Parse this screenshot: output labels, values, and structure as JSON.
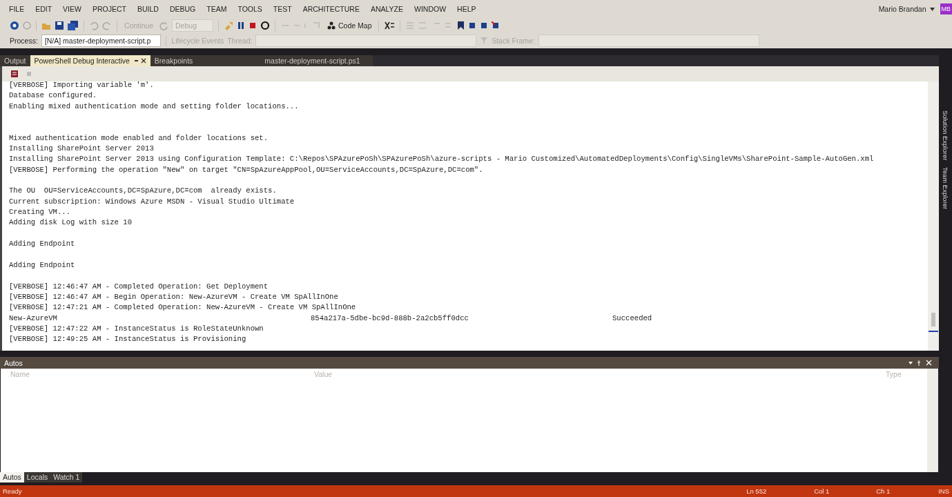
{
  "menu": [
    "FILE",
    "EDIT",
    "VIEW",
    "PROJECT",
    "BUILD",
    "DEBUG",
    "TEAM",
    "TOOLS",
    "TEST",
    "ARCHITECTURE",
    "ANALYZE",
    "WINDOW",
    "HELP"
  ],
  "user": {
    "name": "Mario Brandan",
    "badge": "MB"
  },
  "toolbar": {
    "continue": "Continue",
    "config": "Debug",
    "code_map": "Code Map"
  },
  "debug_location": {
    "process_label": "Process:",
    "process": "[N/A] master-deployment-script.p",
    "lifecycle": "Lifecycle Events",
    "thread_label": "Thread:",
    "stack_frame_label": "Stack Frame:"
  },
  "doc_tabs": [
    {
      "label": "Output",
      "selected": false
    },
    {
      "label": "PowerShell Debug Interactive",
      "selected": true
    },
    {
      "label": "Breakpoints",
      "selected": false
    },
    {
      "label": "master-deployment-script.ps1",
      "selected": false
    }
  ],
  "console": [
    {
      "kind": "text",
      "text": "[VERBOSE] Importing variable 'm'."
    },
    {
      "kind": "text",
      "text": "Database configured."
    },
    {
      "kind": "text",
      "text": "Enabling mixed authentication mode and setting folder locations..."
    },
    {
      "kind": "blank"
    },
    {
      "kind": "blank"
    },
    {
      "kind": "text",
      "text": "Mixed authentication mode enabled and folder locations set."
    },
    {
      "kind": "text",
      "text": "Installing SharePoint Server 2013"
    },
    {
      "kind": "text",
      "text": "Installing SharePoint Server 2013 using Configuration Template: C:\\Repos\\SPAzurePoSh\\SPAzurePoSh\\azure-scripts - Mario Customized\\AutomatedDeployments\\Config\\SingleVMs\\SharePoint-Sample-AutoGen.xml"
    },
    {
      "kind": "text",
      "text": "[VERBOSE] Performing the operation \"New\" on target \"CN=SpAzureAppPool,OU=ServiceAccounts,DC=SpAzure,DC=com\"."
    },
    {
      "kind": "blank"
    },
    {
      "kind": "text",
      "text": "The OU  OU=ServiceAccounts,DC=SpAzure,DC=com  already exists."
    },
    {
      "kind": "text",
      "text": "Current subscription: Windows Azure MSDN - Visual Studio Ultimate"
    },
    {
      "kind": "text",
      "text": "Creating VM..."
    },
    {
      "kind": "text",
      "text": "Adding disk Log with size 10"
    },
    {
      "kind": "blank"
    },
    {
      "kind": "text",
      "text": "Adding Endpoint"
    },
    {
      "kind": "blank"
    },
    {
      "kind": "text",
      "text": "Adding Endpoint"
    },
    {
      "kind": "blank"
    },
    {
      "kind": "text",
      "text": "[VERBOSE] 12:46:47 AM - Completed Operation: Get Deployment"
    },
    {
      "kind": "text",
      "text": "[VERBOSE] 12:46:47 AM - Begin Operation: New-AzureVM - Create VM SpAllInOne"
    },
    {
      "kind": "text",
      "text": "[VERBOSE] 12:47:21 AM - Completed Operation: New-AzureVM - Create VM SpAllInOne"
    },
    {
      "kind": "columns",
      "cells": [
        "New-AzureVM",
        "854a217a-5dbe-bc9d-888b-2a2cb5ff0dcc",
        "Succeeded"
      ]
    },
    {
      "kind": "text",
      "text": "[VERBOSE] 12:47:22 AM - InstanceStatus is RoleStateUnknown"
    },
    {
      "kind": "text",
      "text": "[VERBOSE] 12:49:25 AM - InstanceStatus is Provisioning"
    }
  ],
  "side_tabs": [
    "Solution Explorer",
    "Team Explorer"
  ],
  "autos": {
    "title": "Autos",
    "columns": [
      "Name",
      "Value",
      "Type"
    ]
  },
  "bottom_tabs": [
    {
      "label": "Autos",
      "selected": true
    },
    {
      "label": "Locals",
      "selected": false
    },
    {
      "label": "Watch 1",
      "selected": false
    }
  ],
  "status_bar": {
    "state": "Ready",
    "line": "Ln 552",
    "col": "Col 1",
    "ch": "Ch 1",
    "mode": "INS"
  }
}
